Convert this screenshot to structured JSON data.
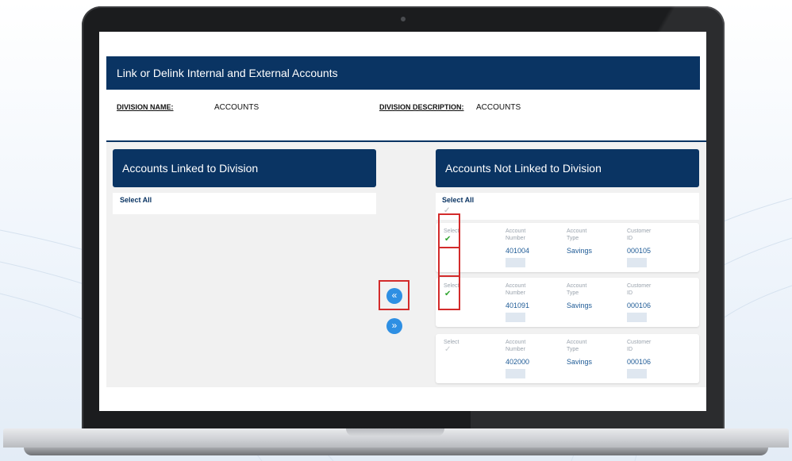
{
  "page": {
    "title": "Link or Delink Internal and External Accounts",
    "division_name_label": "DIVISION NAME:",
    "division_name_value": "ACCOUNTS",
    "division_description_label": "DIVISION DESCRIPTION:",
    "division_description_value": "ACCOUNTS"
  },
  "linked_panel": {
    "title": "Accounts Linked to Division",
    "select_all": "Select All"
  },
  "unlinked_panel": {
    "title": "Accounts Not Linked to Division",
    "select_all": "Select All",
    "columns": {
      "select": "Select",
      "account_number": [
        "Account",
        "Number"
      ],
      "account_type": [
        "Account",
        "Type"
      ],
      "customer_id": [
        "Customer",
        "ID"
      ]
    },
    "rows": [
      {
        "account_number": "401004",
        "account_type": "Savings",
        "customer_id": "000105",
        "selected": true
      },
      {
        "account_number": "401091",
        "account_type": "Savings",
        "customer_id": "000106",
        "selected": true
      },
      {
        "account_number": "402000",
        "account_type": "Savings",
        "customer_id": "000106",
        "selected": false
      }
    ]
  },
  "buttons": {
    "move_left_icon": "«",
    "move_right_icon": "»"
  },
  "colors": {
    "brand_navy": "#0a3463",
    "accent_blue": "#2e8fe3",
    "check_green": "#2fa42f",
    "highlight_red": "#d32b2b"
  }
}
